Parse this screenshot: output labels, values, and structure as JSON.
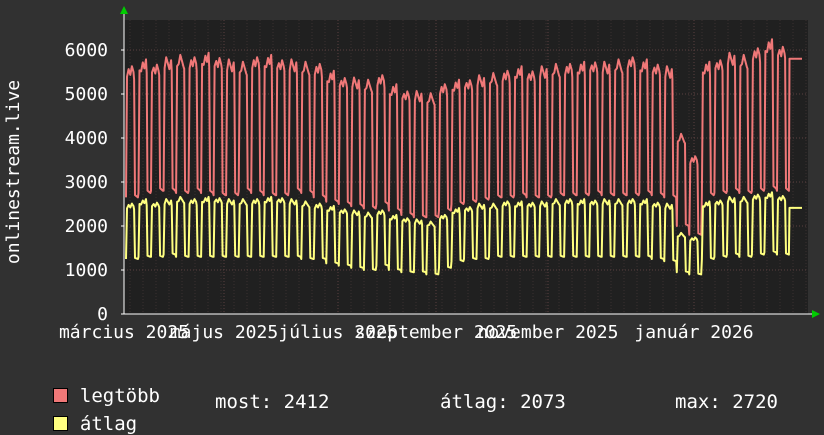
{
  "chart_data": {
    "type": "line",
    "ylabel": "onlinestream.live",
    "ylim": [
      0,
      6500
    ],
    "yticks": [
      0,
      1000,
      2000,
      3000,
      4000,
      5000,
      6000
    ],
    "xtick_labels": [
      "március 2025",
      "május 2025",
      "július 2025",
      "szeptember 2025",
      "november 2025",
      "január 2026"
    ],
    "grid": true,
    "colors": {
      "background": "#313131",
      "plot_bg": "#202020",
      "grid": "#5a4040",
      "axis": "#ffffff",
      "arrow": "#00cc00"
    },
    "series": [
      {
        "name": "legtöbb",
        "color": "#f07878",
        "weekly_high": [
          5500,
          5650,
          5600,
          5700,
          5750,
          5700,
          5800,
          5750,
          5650,
          5600,
          5700,
          5750,
          5700,
          5650,
          5600,
          5550,
          5400,
          5300,
          5250,
          5200,
          5300,
          5100,
          5000,
          4950,
          4900,
          5100,
          5200,
          5250,
          5300,
          5350,
          5400,
          5500,
          5450,
          5500,
          5550,
          5550,
          5600,
          5650,
          5600,
          5650,
          5700,
          5650,
          5600,
          5500,
          4000,
          3500,
          5600,
          5700,
          5800,
          5750,
          5900,
          6100,
          6000,
          5800
        ],
        "weekly_low": [
          2650,
          2750,
          2800,
          2800,
          2750,
          2800,
          2750,
          2700,
          2700,
          2800,
          2750,
          2700,
          2700,
          2800,
          2750,
          2650,
          2550,
          2500,
          2450,
          2400,
          2500,
          2350,
          2250,
          2200,
          2200,
          2350,
          2500,
          2550,
          2600,
          2650,
          2650,
          2700,
          2650,
          2650,
          2700,
          2700,
          2700,
          2750,
          2700,
          2700,
          2700,
          2750,
          2700,
          2650,
          2000,
          1800,
          2700,
          2750,
          2800,
          2750,
          2800,
          2850,
          2800,
          5800
        ]
      },
      {
        "name": "átlag",
        "color": "#ffff80",
        "weekly_high": [
          2450,
          2550,
          2500,
          2550,
          2600,
          2550,
          2600,
          2600,
          2550,
          2550,
          2550,
          2600,
          2600,
          2550,
          2500,
          2450,
          2400,
          2350,
          2300,
          2250,
          2300,
          2200,
          2150,
          2100,
          2050,
          2200,
          2350,
          2400,
          2450,
          2450,
          2500,
          2500,
          2500,
          2500,
          2550,
          2550,
          2550,
          2550,
          2550,
          2550,
          2550,
          2550,
          2500,
          2450,
          1800,
          1700,
          2500,
          2550,
          2600,
          2600,
          2650,
          2700,
          2650,
          2412
        ],
        "weekly_low": [
          1250,
          1300,
          1300,
          1350,
          1300,
          1300,
          1300,
          1300,
          1300,
          1300,
          1300,
          1300,
          1300,
          1300,
          1250,
          1250,
          1150,
          1100,
          1050,
          1000,
          1100,
          1000,
          950,
          950,
          900,
          1050,
          1200,
          1250,
          1250,
          1300,
          1300,
          1300,
          1300,
          1300,
          1300,
          1300,
          1300,
          1300,
          1300,
          1300,
          1300,
          1300,
          1250,
          1200,
          950,
          900,
          1250,
          1300,
          1350,
          1300,
          1350,
          1400,
          1350,
          2412
        ]
      }
    ]
  },
  "legend": {
    "items": [
      {
        "label": "legtöbb",
        "color": "#f07878"
      },
      {
        "label": "átlag",
        "color": "#ffff80"
      }
    ],
    "stats": {
      "now": "most: 2412",
      "avg": "átlag: 2073",
      "max": "max: 2720"
    }
  }
}
